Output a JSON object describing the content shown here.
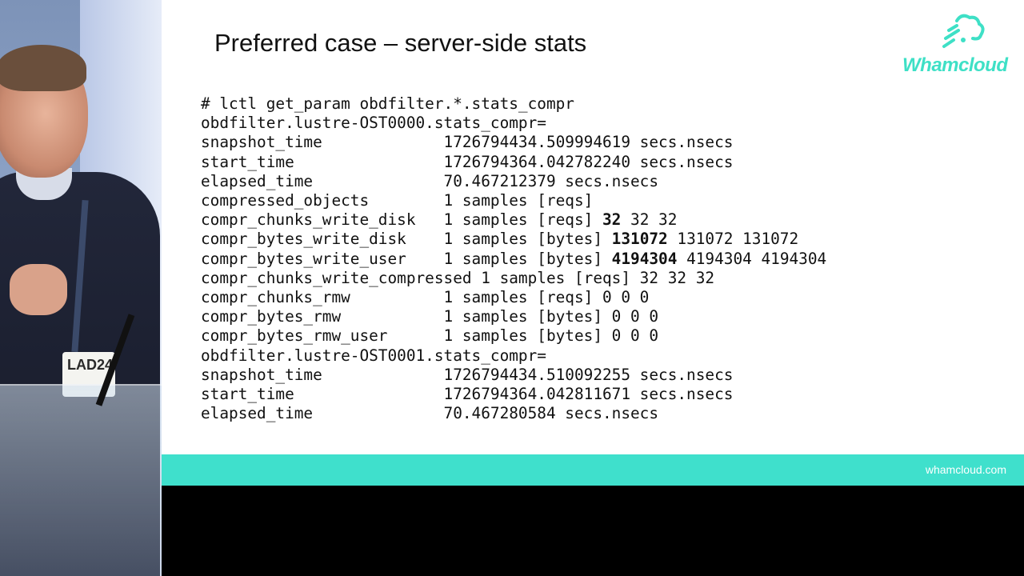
{
  "camera": {
    "badge_text": "LAD24"
  },
  "slide": {
    "title": "Preferred case – server-side stats",
    "logo_text": "Whamcloud",
    "footer_url": "whamcloud.com",
    "brand_color": "#3fe0cc",
    "code_lines": [
      {
        "parts": [
          {
            "t": "# lctl get_param obdfilter.*.stats_compr"
          }
        ]
      },
      {
        "parts": [
          {
            "t": "obdfilter.lustre-OST0000.stats_compr="
          }
        ]
      },
      {
        "parts": [
          {
            "t": "snapshot_time             1726794434.509994619 secs.nsecs"
          }
        ]
      },
      {
        "parts": [
          {
            "t": "start_time                1726794364.042782240 secs.nsecs"
          }
        ]
      },
      {
        "parts": [
          {
            "t": "elapsed_time              70.467212379 secs.nsecs"
          }
        ]
      },
      {
        "parts": [
          {
            "t": "compressed_objects        1 samples [reqs]"
          }
        ]
      },
      {
        "parts": [
          {
            "t": "compr_chunks_write_disk   1 samples [reqs] "
          },
          {
            "t": "32",
            "b": true
          },
          {
            "t": " 32 32"
          }
        ]
      },
      {
        "parts": [
          {
            "t": "compr_bytes_write_disk    1 samples [bytes] "
          },
          {
            "t": "131072",
            "b": true
          },
          {
            "t": " 131072 131072"
          }
        ]
      },
      {
        "parts": [
          {
            "t": "compr_bytes_write_user    1 samples [bytes] "
          },
          {
            "t": "4194304",
            "b": true
          },
          {
            "t": " 4194304 4194304"
          }
        ]
      },
      {
        "parts": [
          {
            "t": "compr_chunks_write_compressed 1 samples [reqs] 32 32 32"
          }
        ]
      },
      {
        "parts": [
          {
            "t": "compr_chunks_rmw          1 samples [reqs] 0 0 0"
          }
        ]
      },
      {
        "parts": [
          {
            "t": "compr_bytes_rmw           1 samples [bytes] 0 0 0"
          }
        ]
      },
      {
        "parts": [
          {
            "t": "compr_bytes_rmw_user      1 samples [bytes] 0 0 0"
          }
        ]
      },
      {
        "parts": [
          {
            "t": "obdfilter.lustre-OST0001.stats_compr="
          }
        ]
      },
      {
        "parts": [
          {
            "t": "snapshot_time             1726794434.510092255 secs.nsecs"
          }
        ]
      },
      {
        "parts": [
          {
            "t": "start_time                1726794364.042811671 secs.nsecs"
          }
        ]
      },
      {
        "parts": [
          {
            "t": "elapsed_time              70.467280584 secs.nsecs"
          }
        ]
      }
    ]
  }
}
